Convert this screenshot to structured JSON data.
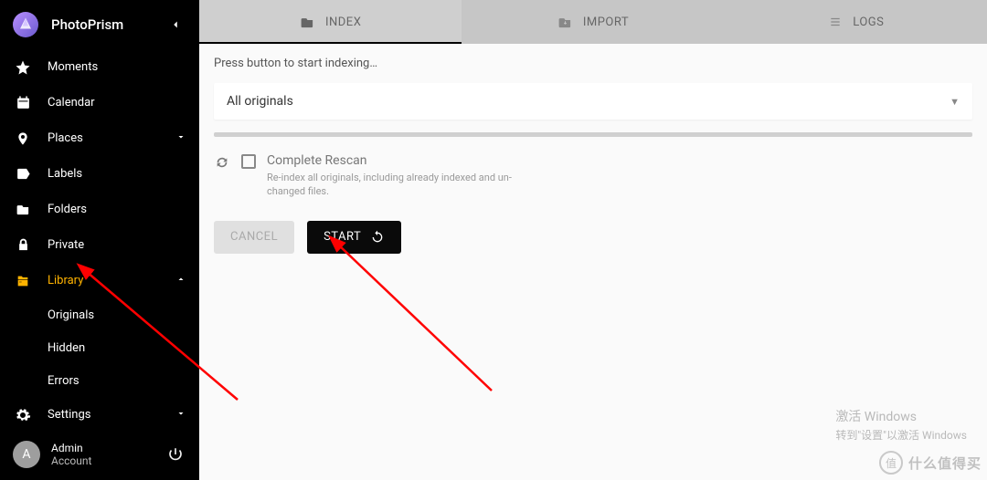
{
  "app": {
    "title": "PhotoPrism"
  },
  "sidebar": {
    "items": [
      {
        "label": "Moments"
      },
      {
        "label": "Calendar"
      },
      {
        "label": "Places"
      },
      {
        "label": "Labels"
      },
      {
        "label": "Folders"
      },
      {
        "label": "Private"
      },
      {
        "label": "Library"
      },
      {
        "label": "Settings"
      }
    ],
    "library_sub": [
      {
        "label": "Originals"
      },
      {
        "label": "Hidden"
      },
      {
        "label": "Errors"
      }
    ],
    "account": {
      "initial": "A",
      "name": "Admin",
      "role": "Account"
    }
  },
  "tabs": [
    {
      "label": "INDEX"
    },
    {
      "label": "IMPORT"
    },
    {
      "label": "LOGS"
    }
  ],
  "index": {
    "hint": "Press button to start indexing…",
    "select_value": "All originals",
    "rescan_title": "Complete Rescan",
    "rescan_desc": "Re-index all originals, including already indexed and un-\nchanged files.",
    "cancel_label": "CANCEL",
    "start_label": "START"
  },
  "watermark": {
    "line1": "激活 Windows",
    "line2": "转到\"设置\"以激活 Windows",
    "brand": "什么值得买",
    "badge": "值"
  }
}
